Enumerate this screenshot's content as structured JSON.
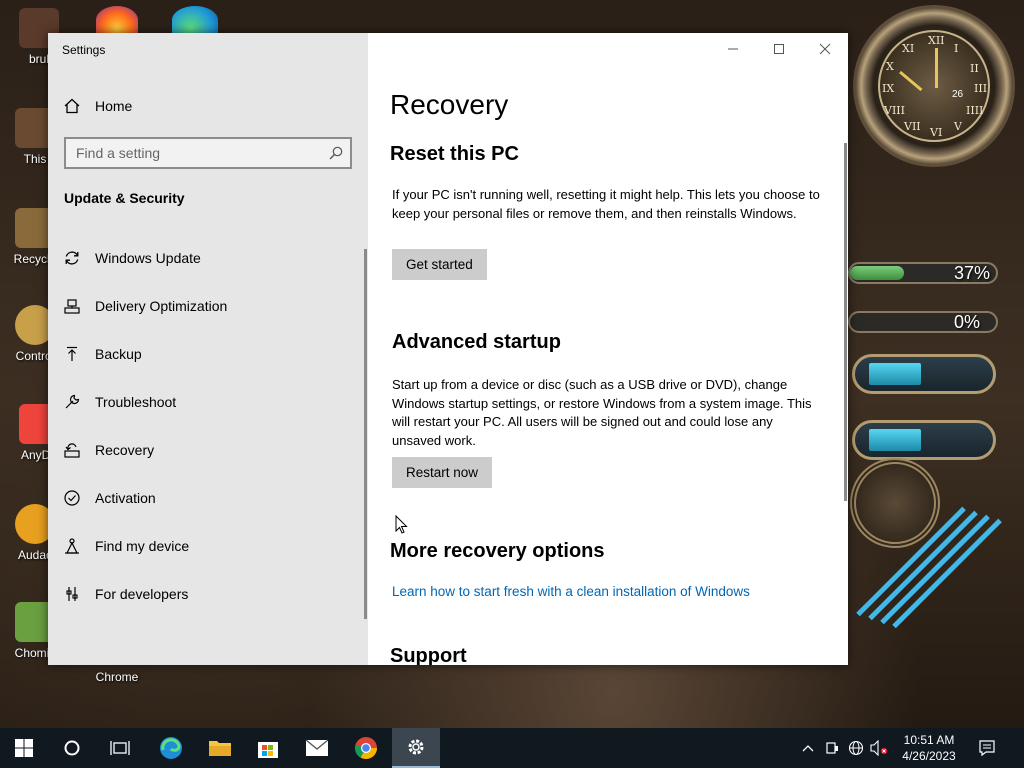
{
  "desktop": {
    "icons": [
      {
        "label": "brul"
      },
      {
        "label": "This"
      },
      {
        "label": "Recycle"
      },
      {
        "label": "Control"
      },
      {
        "label": "AnyDe"
      },
      {
        "label": "Audac"
      },
      {
        "label": "Chomik"
      },
      {
        "label": "Chrome"
      }
    ],
    "gadgets": {
      "clock_date": "26",
      "clock_numerals": [
        "XII",
        "I",
        "II",
        "III",
        "IIII",
        "V",
        "VI",
        "VII",
        "VIII",
        "IX",
        "X",
        "XI"
      ],
      "meter1_label": "37%",
      "meter1_value": 0.37,
      "meter2_label": "0%",
      "meter2_value": 0.0
    }
  },
  "window": {
    "title": "Settings",
    "controls": {
      "minimize": "—",
      "maximize": "☐",
      "close": "✕"
    },
    "nav": {
      "home_label": "Home",
      "search_placeholder": "Find a setting",
      "section_header": "Update & Security",
      "items": [
        {
          "label": "Windows Update",
          "icon": "refresh-icon"
        },
        {
          "label": "Delivery Optimization",
          "icon": "delivery-optimization-icon"
        },
        {
          "label": "Backup",
          "icon": "backup-arrow-icon"
        },
        {
          "label": "Troubleshoot",
          "icon": "wrench-icon"
        },
        {
          "label": "Recovery",
          "icon": "recovery-icon"
        },
        {
          "label": "Activation",
          "icon": "check-circle-icon"
        },
        {
          "label": "Find my device",
          "icon": "find-device-icon"
        },
        {
          "label": "For developers",
          "icon": "developer-tools-icon"
        }
      ]
    },
    "content": {
      "page_title": "Recovery",
      "reset": {
        "heading": "Reset this PC",
        "description": "If your PC isn't running well, resetting it might help. This lets you choose to keep your personal files or remove them, and then reinstalls Windows.",
        "button": "Get started"
      },
      "advanced": {
        "heading": "Advanced startup",
        "description": "Start up from a device or disc (such as a USB drive or DVD), change Windows startup settings, or restore Windows from a system image. This will restart your PC. All users will be signed out and could lose any unsaved work.",
        "button": "Restart now"
      },
      "more": {
        "heading": "More recovery options",
        "link": "Learn how to start fresh with a clean installation of Windows"
      },
      "support": {
        "heading": "Support"
      }
    }
  },
  "taskbar": {
    "apps": [
      "start-icon",
      "cortana-icon",
      "task-view-icon",
      "edge-icon",
      "file-explorer-icon",
      "store-icon",
      "mail-icon",
      "chrome-icon",
      "settings-icon"
    ],
    "time": "10:51 AM",
    "date": "4/26/2023"
  },
  "colors": {
    "accent_link": "#0066b4",
    "nav_bg": "#e6e6e6",
    "button_bg": "#cccccc",
    "taskbar_bg": "#101820"
  }
}
